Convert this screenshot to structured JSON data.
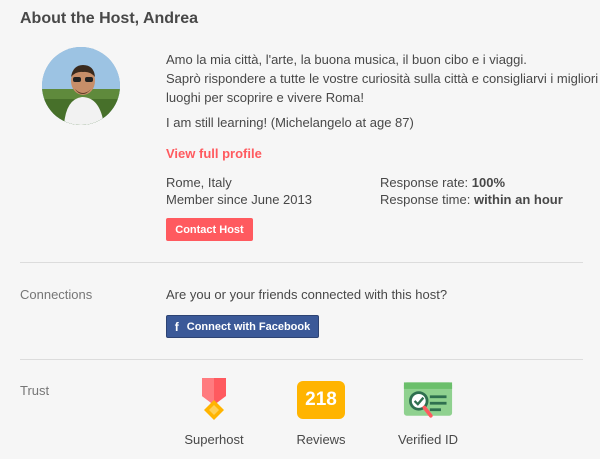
{
  "header": {
    "title": "About the Host, Andrea"
  },
  "host": {
    "bio_lines": [
      "Amo la mia città, l'arte, la buona musica, il buon cibo e i viaggi.",
      "Saprò rispondere a tutte le vostre curiosità sulla città e consigliarvi i migliori",
      "luoghi per scoprire e vivere Roma!"
    ],
    "quote": "I am still learning! (Michelangelo at age 87)",
    "view_profile_label": "View full profile",
    "location": "Rome, Italy",
    "member_since": "Member since June 2013",
    "response_rate_label": "Response rate:",
    "response_rate_value": "100%",
    "response_time_label": "Response time:",
    "response_time_value": "within an hour",
    "contact_button_label": "Contact Host"
  },
  "connections": {
    "section_label": "Connections",
    "question": "Are you or your friends connected with this host?",
    "facebook_button_label": "Connect with Facebook",
    "facebook_icon_glyph": "f"
  },
  "trust": {
    "section_label": "Trust",
    "badges": [
      {
        "label": "Superhost",
        "icon": "superhost-medal-icon"
      },
      {
        "label": "Reviews",
        "value": "218",
        "icon": "reviews-count-icon"
      },
      {
        "label": "Verified ID",
        "icon": "verified-id-icon"
      }
    ]
  },
  "colors": {
    "accent": "#ff5a5f",
    "facebook": "#3b5998",
    "reviews_badge": "#ffb400",
    "verified_badge": "#8fd18f"
  }
}
